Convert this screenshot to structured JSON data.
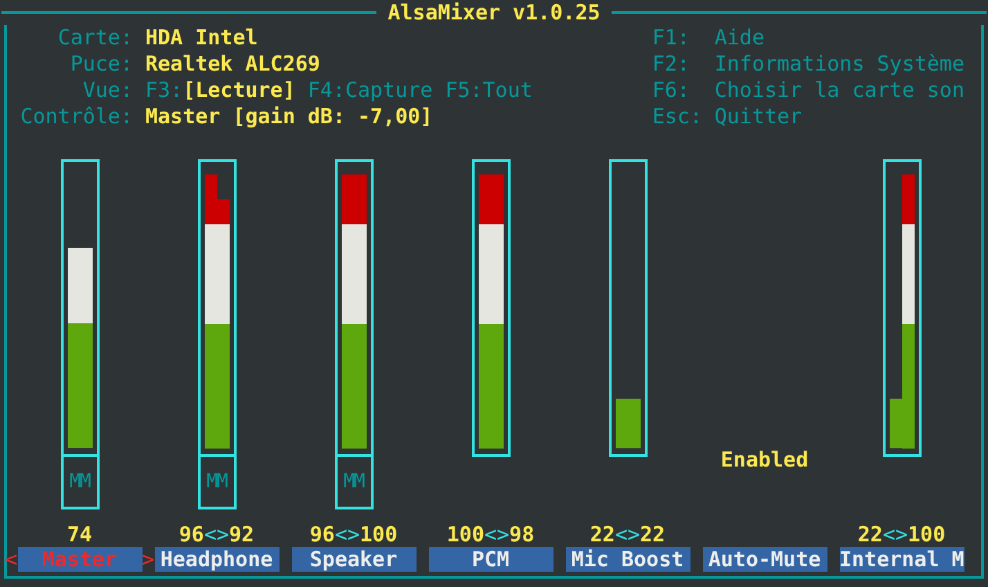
{
  "window": {
    "title": "AlsaMixer v1.0.25"
  },
  "info": [
    {
      "kind": "value",
      "label": "Carte:",
      "value": "HDA Intel"
    },
    {
      "kind": "value",
      "label": "Puce:",
      "value": "Realtek ALC269"
    },
    {
      "kind": "views",
      "label": "Vue:",
      "views": [
        {
          "key": "F3:",
          "label": "[Lecture]",
          "selected": true
        },
        {
          "key": "F4:",
          "label": "Capture",
          "selected": false
        },
        {
          "key": "F5:",
          "label": "Tout",
          "selected": false
        }
      ]
    },
    {
      "kind": "value",
      "label": "Contrôle:",
      "value": "Master [gain dB: -7,00]"
    }
  ],
  "help": [
    {
      "key": "F1:",
      "action": "Aide"
    },
    {
      "key": "F2:",
      "action": "Informations Système"
    },
    {
      "key": "F6:",
      "action": "Choisir la carte son"
    },
    {
      "key": "Esc:",
      "action": "Quitter"
    }
  ],
  "selection_marks": [
    "<",
    ">"
  ],
  "channels": [
    {
      "name": "Master",
      "kind": "volume",
      "selected": true,
      "mute_label": "MM",
      "bars": [
        {
          "level": 0.73
        }
      ],
      "reading": [
        "74"
      ]
    },
    {
      "name": "Headphone",
      "kind": "volume",
      "selected": false,
      "mute_label": "MM",
      "bars": [
        {
          "level": 1.0
        },
        {
          "level": 0.91
        }
      ],
      "reading": [
        "96",
        "<>",
        "92"
      ]
    },
    {
      "name": "Speaker",
      "kind": "volume",
      "selected": false,
      "mute_label": "MM",
      "bars": [
        {
          "level": 1.0
        },
        {
          "level": 1.0
        }
      ],
      "reading": [
        "96",
        "<>",
        "100"
      ]
    },
    {
      "name": "PCM",
      "kind": "volume",
      "selected": false,
      "bars": [
        {
          "level": 1.0
        },
        {
          "level": 1.0
        }
      ],
      "reading": [
        "100",
        "<>",
        "98"
      ]
    },
    {
      "name": "Mic Boost",
      "kind": "volume",
      "selected": false,
      "bars": [
        {
          "level": 0.18
        }
      ],
      "reading": [
        "22",
        "<>",
        "22"
      ]
    },
    {
      "name": "Auto-Mute",
      "kind": "switch",
      "selected": false,
      "state": "Enabled"
    },
    {
      "name": "Internal M",
      "kind": "volume",
      "selected": false,
      "bars": [
        {
          "level": 0.18
        },
        {
          "level": 1.0
        }
      ],
      "reading": [
        "22",
        "<>",
        "100"
      ]
    }
  ]
}
